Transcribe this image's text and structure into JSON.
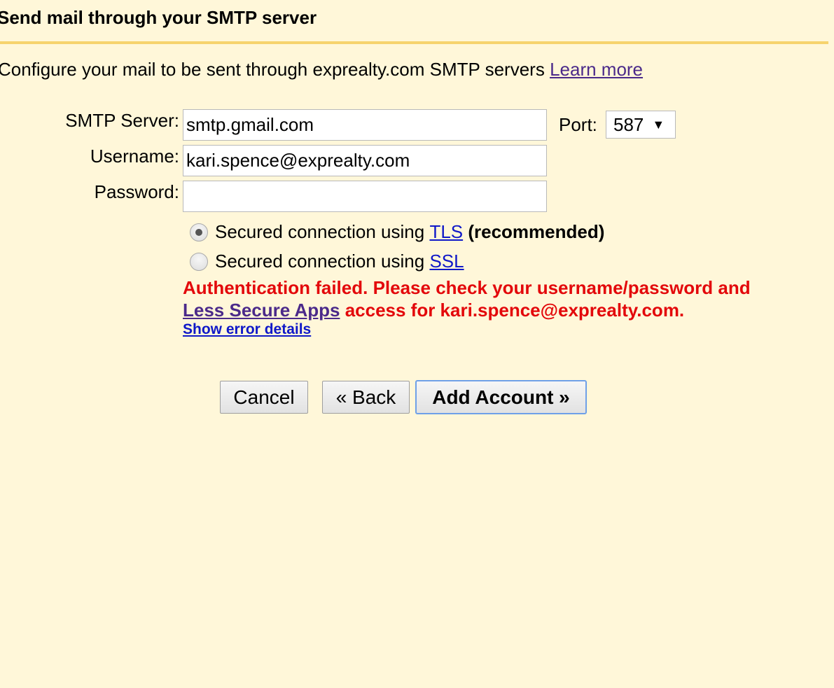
{
  "dialog": {
    "title": "Send mail through your SMTP server",
    "intro_text": "Configure your mail to be sent through exprealty.com SMTP servers ",
    "learn_more_label": "Learn more"
  },
  "form": {
    "smtp_server": {
      "label": "SMTP Server:",
      "value": "smtp.gmail.com"
    },
    "port": {
      "label": "Port:",
      "selected": "587"
    },
    "username": {
      "label": "Username:",
      "value": "kari.spence@exprealty.com"
    },
    "password": {
      "label": "Password:",
      "value": ""
    },
    "security": {
      "options": [
        {
          "prefix": "Secured connection using ",
          "link": "TLS",
          "suffix": " (recommended)",
          "checked": true
        },
        {
          "prefix": "Secured connection using ",
          "link": "SSL",
          "suffix": "",
          "checked": false
        }
      ]
    }
  },
  "error": {
    "line1": "Authentication failed. Please check your username/password and",
    "link_label": "Less Secure Apps",
    "line2_suffix": " access for kari.spence@exprealty.com.",
    "details_label": "Show error details",
    "color": "#e3080b"
  },
  "buttons": {
    "cancel": "Cancel",
    "back": "« Back",
    "add_account": "Add Account »"
  },
  "icons": {
    "dropdown_arrow": "▼"
  },
  "colors": {
    "background": "#fff7d9",
    "rule": "#f6d36d",
    "link_visited": "#4b2a8a",
    "link": "#0f18c8",
    "primary_border": "#6fa0e8"
  }
}
